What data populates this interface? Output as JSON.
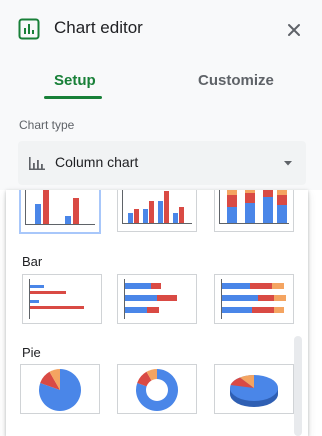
{
  "header": {
    "title": "Chart editor"
  },
  "tabs": [
    {
      "label": "Setup"
    },
    {
      "label": "Customize"
    }
  ],
  "chart_type": {
    "label": "Chart type",
    "selected": "Column chart"
  },
  "sections": [
    {
      "title": "Bar"
    },
    {
      "title": "Pie"
    }
  ],
  "colors": {
    "accent": "#188038",
    "blue": "#4a86e8",
    "red": "#d94a44",
    "orange": "#f4a461",
    "selection": "#a8c7fa"
  }
}
